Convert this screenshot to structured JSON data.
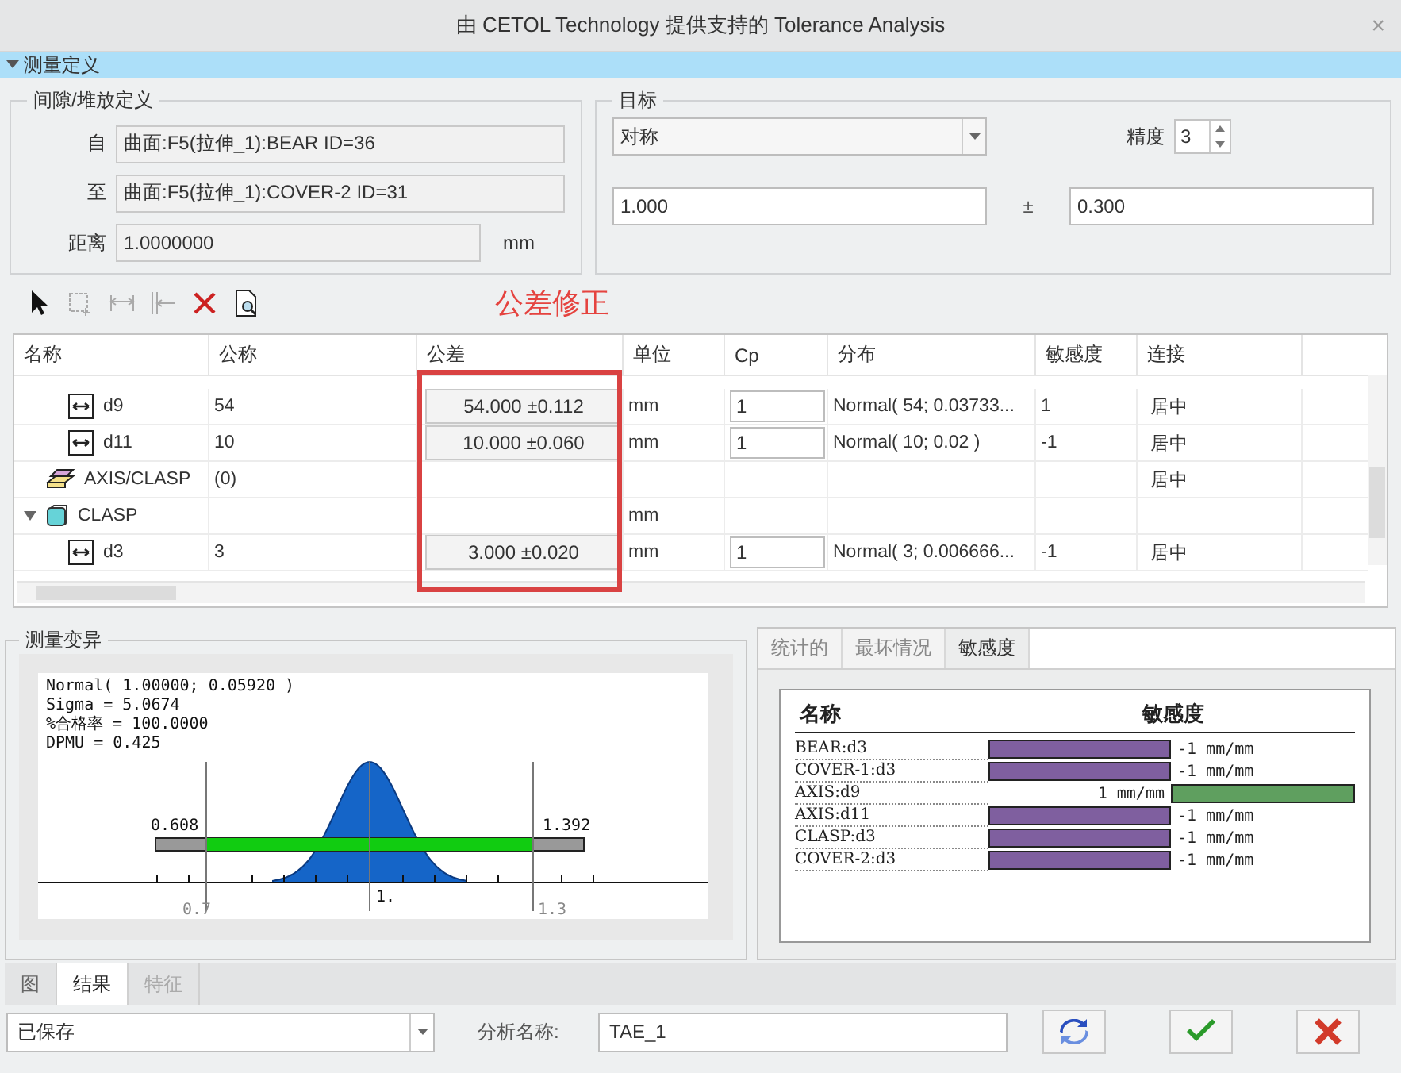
{
  "window": {
    "title": "由 CETOL Technology 提供支持的 Tolerance Analysis",
    "close": "×"
  },
  "section": {
    "title": "测量定义",
    "expanded": true
  },
  "clearance": {
    "title": "间隙/堆放定义",
    "fields": [
      {
        "label": "自",
        "value": "曲面:F5(拉伸_1):BEAR ID=36"
      },
      {
        "label": "至",
        "value": "曲面:F5(拉伸_1):COVER-2 ID=31"
      }
    ],
    "distance": {
      "label": "距离",
      "value": "1.0000000",
      "unit": "mm"
    }
  },
  "target": {
    "title": "目标",
    "mode": "对称",
    "precision_label": "精度",
    "precision": "3",
    "nominal": "1.000",
    "plus_minus": "±",
    "tolerance": "0.300"
  },
  "annotation": "公差修正",
  "table": {
    "columns": [
      "名称",
      "公称",
      "公差",
      "单位",
      "Cp",
      "分布",
      "敏感度",
      "连接"
    ],
    "rows": [
      {
        "kind": "dimension",
        "name": "d9",
        "nominal": "54",
        "tolerance": "54.000 ±0.112",
        "unit": "mm",
        "cp": "1",
        "distribution": "Normal( 54; 0.03733...",
        "sensitivity": "1",
        "connection": "居中"
      },
      {
        "kind": "dimension",
        "name": "d11",
        "nominal": "10",
        "tolerance": "10.000 ±0.060",
        "unit": "mm",
        "cp": "1",
        "distribution": "Normal( 10; 0.02 )",
        "sensitivity": "-1",
        "connection": "居中"
      },
      {
        "kind": "contact",
        "name": "AXIS/CLASP",
        "nominal": "(0)",
        "connection": "居中"
      },
      {
        "kind": "part",
        "name": "CLASP",
        "unit": "mm",
        "expanded": true,
        "children": [
          {
            "kind": "dimension",
            "name": "d3",
            "nominal": "3",
            "tolerance": "3.000 ±0.020",
            "unit": "mm",
            "cp": "1",
            "distribution": "Normal( 3; 0.006666...",
            "sensitivity": "-1",
            "connection": "居中"
          }
        ]
      }
    ]
  },
  "variation": {
    "title": "测量变异",
    "stats": [
      "Normal( 1.00000; 0.05920 )",
      "Sigma  = 5.0674",
      "%合格率 = 100.0000",
      "DPMU   = 0.425"
    ],
    "low": "0.608",
    "high": "1.392",
    "ticks": [
      "0.7",
      "1.",
      "1.3"
    ]
  },
  "result_tabs": [
    {
      "label": "统计的",
      "selected": false
    },
    {
      "label": "最坏情况",
      "selected": false
    },
    {
      "label": "敏感度",
      "selected": true
    }
  ],
  "sensitivity": {
    "name_header": "名称",
    "value_header": "敏感度",
    "rows": [
      {
        "name": "BEAR:d3",
        "value": "-1  mm/mm",
        "color": "#7f5f9f",
        "positive": false
      },
      {
        "name": "COVER-1:d3",
        "value": "-1  mm/mm",
        "color": "#7f5f9f",
        "positive": false
      },
      {
        "name": "AXIS:d9",
        "value": "1  mm/mm",
        "color": "#5f9f5f",
        "positive": true
      },
      {
        "name": "AXIS:d11",
        "value": "-1  mm/mm",
        "color": "#7f5f9f",
        "positive": false
      },
      {
        "name": "CLASP:d3",
        "value": "-1  mm/mm",
        "color": "#7f5f9f",
        "positive": false
      },
      {
        "name": "COVER-2:d3",
        "value": "-1  mm/mm",
        "color": "#7f5f9f",
        "positive": false
      }
    ]
  },
  "bottom_tabs": [
    {
      "label": "图",
      "selected": false,
      "disabled": false
    },
    {
      "label": "结果",
      "selected": true,
      "disabled": false
    },
    {
      "label": "特征",
      "selected": false,
      "disabled": true
    }
  ],
  "footer": {
    "status": "已保存",
    "name_label": "分析名称:",
    "name": "TAE_1"
  }
}
